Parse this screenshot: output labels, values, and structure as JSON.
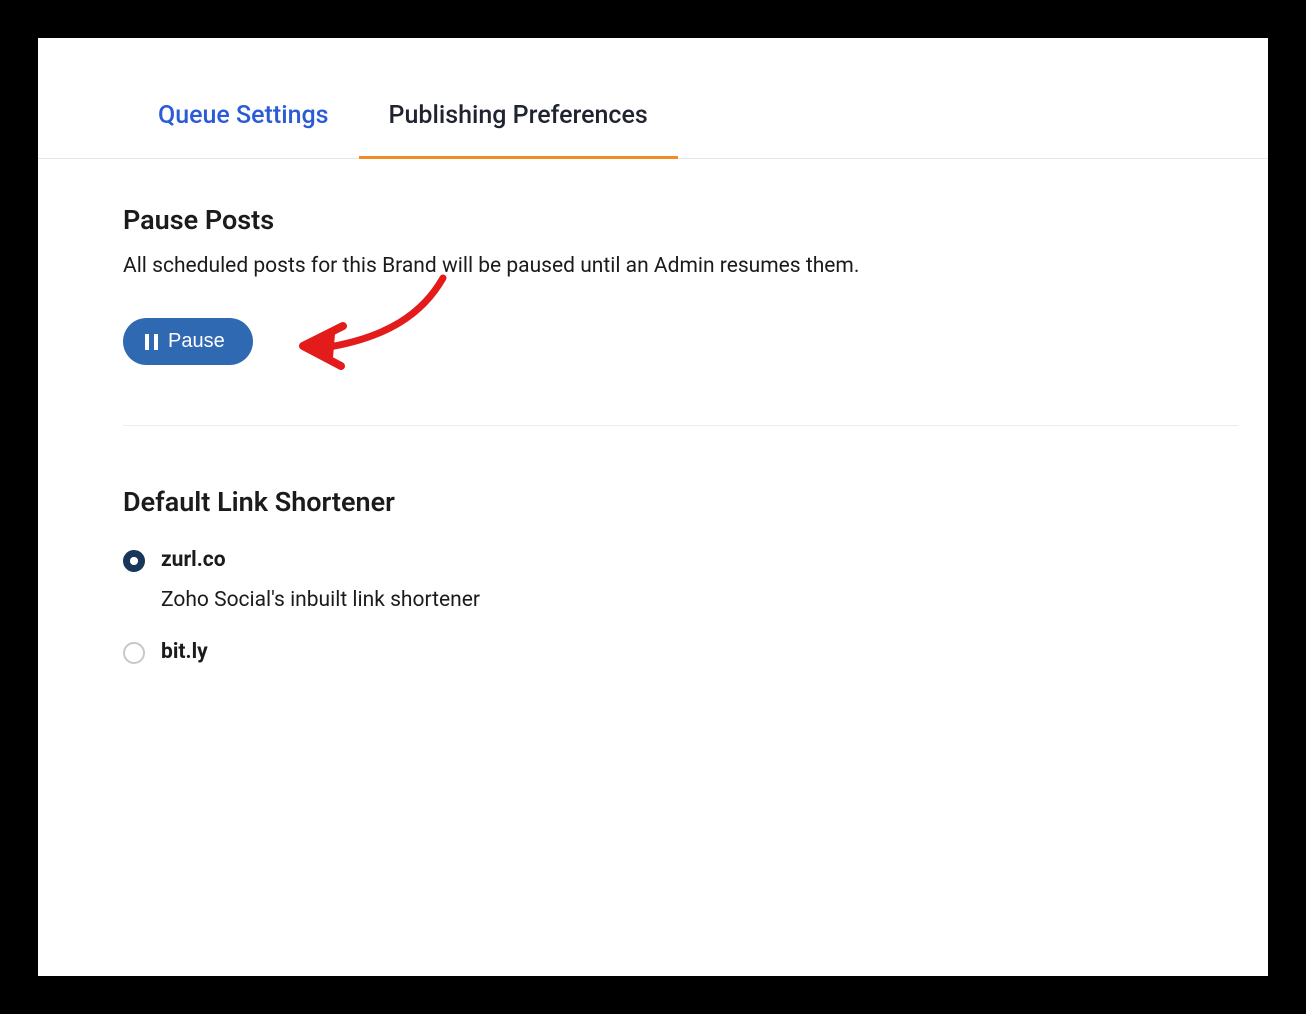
{
  "tabs": {
    "queue": "Queue Settings",
    "publishing": "Publishing Preferences"
  },
  "pause": {
    "title": "Pause Posts",
    "desc": "All scheduled posts for this Brand will be paused until an Admin resumes them.",
    "button_label": "Pause"
  },
  "shortener": {
    "title": "Default Link Shortener",
    "options": [
      {
        "label": "zurl.co",
        "sub": "Zoho Social's inbuilt link shortener",
        "selected": true
      },
      {
        "label": "bit.ly",
        "sub": "",
        "selected": false
      }
    ]
  },
  "colors": {
    "accent_blue": "#2b5bd7",
    "button_blue": "#2f69b2",
    "tab_underline": "#f48b29",
    "radio_selected": "#17365a",
    "annotation_red": "#e41b1b"
  }
}
